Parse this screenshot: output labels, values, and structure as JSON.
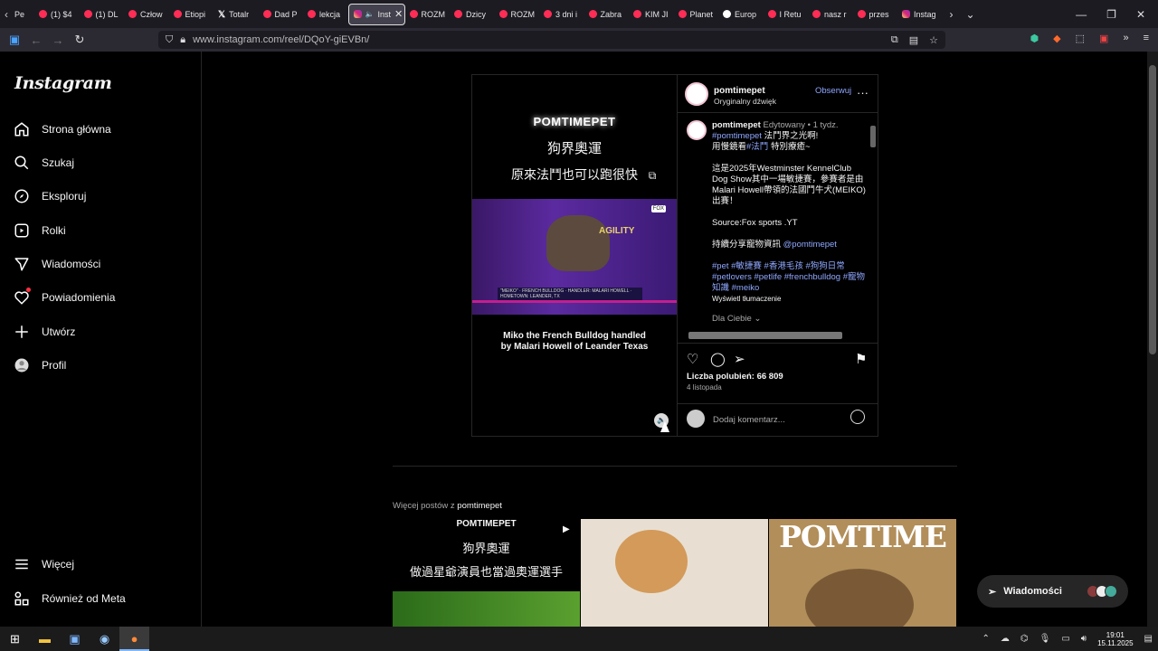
{
  "browser": {
    "tabs": [
      {
        "label": "(1) $4",
        "icon": "youtube"
      },
      {
        "label": "(1) DL",
        "icon": "youtube"
      },
      {
        "label": "Człow",
        "icon": "youtube"
      },
      {
        "label": "Etiopi",
        "icon": "youtube"
      },
      {
        "label": "Totalr",
        "icon": "x"
      },
      {
        "label": "Dad P",
        "icon": "youtube"
      },
      {
        "label": "lekcja",
        "icon": "youtube"
      }
    ],
    "active_tab": {
      "label": "Inst",
      "icon": "instagram"
    },
    "tabs_after": [
      {
        "label": "ROZM",
        "icon": "youtube"
      },
      {
        "label": "Dzicy",
        "icon": "youtube"
      },
      {
        "label": "ROZM",
        "icon": "youtube"
      },
      {
        "label": "3 dni i",
        "icon": "youtube"
      },
      {
        "label": "Zabra",
        "icon": "youtube"
      },
      {
        "label": "KIM JI",
        "icon": "youtube"
      },
      {
        "label": "Planet",
        "icon": "youtube"
      },
      {
        "label": "Europ",
        "icon": "generic"
      },
      {
        "label": "I Retu",
        "icon": "youtube"
      },
      {
        "label": "nasz r",
        "icon": "youtube"
      },
      {
        "label": "przes",
        "icon": "youtube"
      },
      {
        "label": "Instag",
        "icon": "instagram"
      }
    ],
    "first_tab_label": "Pe",
    "url": "www.instagram.com/reel/DQoY-giEVBn/"
  },
  "sidebar": {
    "logo": "Instagram",
    "items": [
      {
        "label": "Strona główna",
        "icon": "home-icon"
      },
      {
        "label": "Szukaj",
        "icon": "search-icon"
      },
      {
        "label": "Eksploruj",
        "icon": "compass-icon"
      },
      {
        "label": "Rolki",
        "icon": "reels-icon"
      },
      {
        "label": "Wiadomości",
        "icon": "messenger-icon"
      },
      {
        "label": "Powiadomienia",
        "icon": "heart-icon"
      },
      {
        "label": "Utwórz",
        "icon": "plus-icon"
      },
      {
        "label": "Profil",
        "icon": "profile-icon"
      }
    ],
    "bottom": [
      {
        "label": "Więcej",
        "icon": "menu-icon"
      },
      {
        "label": "Również od Meta",
        "icon": "meta-icon"
      }
    ]
  },
  "video": {
    "brand": "POMTIMEPET",
    "line1": "狗界奧運",
    "line2": "原來法鬥也可以跑很快",
    "agility": "AGILITY",
    "lower_third": "\"MEIKO\" · FRENCH BULLDOG · HANDLER: MALARI HOWELL · HOMETOWN: LEANDER, TX",
    "caption": "Miko the French Bulldog handled by Malari Howell of Leander Texas"
  },
  "post": {
    "username": "pomtimepet",
    "audio": "Oryginalny dźwięk",
    "follow": "Obserwuj",
    "caption_user": "pomtimepet",
    "edited": "Edytowany",
    "time": "1 tydz.",
    "line1_tag": "#pomtimepet",
    "line1_text": "法鬥界之光啊!",
    "line2_pre": "用慢鏡看",
    "line2_tag": "#法鬥",
    "line2_post": "特別療癒~",
    "para1": "這是2025年Westminster KennelClub Dog Show其中一場敏捷賽，參賽者是由Malari Howell帶領的法國鬥牛犬(MEIKO)出賽！",
    "source": "Source:Fox sports .YT",
    "share_pre": "持續分享寵物資訊",
    "share_tag": "@pomtimepet",
    "hashtags": "#pet #敏捷賽 #香港毛孩 #狗狗日常 #petlovers #petlife #frenchbulldog #寵物知識 #meiko",
    "translate": "Wyświetl tłumaczenie",
    "for_you": "Dla Ciebie",
    "likes": "Liczba polubień: 66 809",
    "date": "4 listopada",
    "comment_placeholder": "Dodaj komentarz..."
  },
  "more_posts": {
    "prefix": "Więcej postów z",
    "user": "pomtimepet",
    "thumb1": {
      "brand": "POMTIMEPET",
      "line1": "狗界奧運",
      "line2": "做過星爺演員也當過奧運選手"
    },
    "thumb3": {
      "brand": "POMTIME"
    }
  },
  "dm": {
    "label": "Wiadomości"
  },
  "taskbar": {
    "time": "19:01",
    "date": "15.11.2025"
  },
  "colors": {
    "accent_link": "#8fa7ff",
    "notification": "#ff3040"
  }
}
